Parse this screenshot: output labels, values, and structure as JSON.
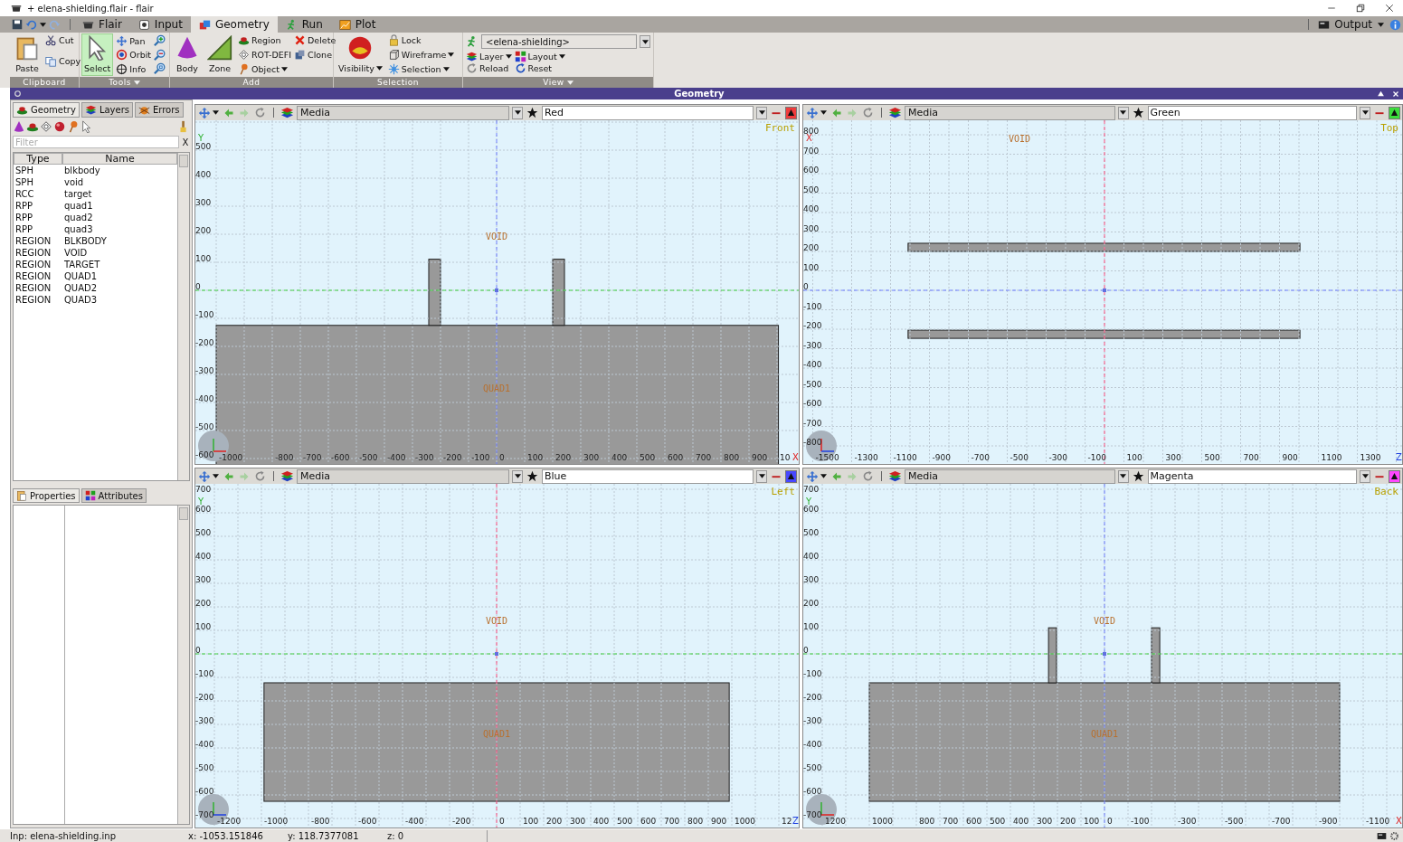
{
  "window": {
    "title": "+ elena-shielding.flair - flair"
  },
  "menu_tabs": [
    {
      "label": "Flair",
      "selected": false
    },
    {
      "label": "Input",
      "selected": false
    },
    {
      "label": "Geometry",
      "selected": true
    },
    {
      "label": "Run",
      "selected": false
    },
    {
      "label": "Plot",
      "selected": false
    }
  ],
  "output_menu": {
    "label": "Output"
  },
  "ribbon": [
    {
      "label": "Clipboard",
      "has_menu": false,
      "items": [
        {
          "kind": "large",
          "label": "Paste",
          "has_menu": false
        },
        {
          "kind": "small",
          "label": "Cut",
          "has_menu": false
        },
        {
          "kind": "small",
          "label": "Copy",
          "has_menu": false
        }
      ]
    },
    {
      "label": "Tools",
      "has_menu": true,
      "items": [
        {
          "kind": "large",
          "label": "Select",
          "has_menu": false,
          "selected": true
        },
        {
          "kind": "small",
          "label": "Pan",
          "has_menu": false,
          "selected": false
        },
        {
          "kind": "small",
          "label": "Orbit",
          "has_menu": false,
          "selected": false
        },
        {
          "kind": "small",
          "label": "Info",
          "has_menu": false,
          "selected": false
        },
        {
          "kind": "icon",
          "has_menu": false,
          "selected": false
        },
        {
          "kind": "icon",
          "has_menu": false,
          "selected": false
        },
        {
          "kind": "icon",
          "has_menu": false,
          "selected": false
        }
      ]
    },
    {
      "label": "Add",
      "has_menu": false,
      "items": [
        {
          "kind": "large",
          "label": "Body",
          "has_menu": false
        },
        {
          "kind": "large",
          "label": "Zone",
          "has_menu": false
        },
        {
          "kind": "small",
          "label": "Region",
          "has_menu": false
        },
        {
          "kind": "small",
          "label": "ROT-DEFI",
          "has_menu": false
        },
        {
          "kind": "small",
          "label": "Object",
          "has_menu": true
        },
        {
          "kind": "small",
          "label": "Delete",
          "has_menu": false
        },
        {
          "kind": "small",
          "label": "Clone",
          "has_menu": false
        }
      ]
    },
    {
      "label": "Selection",
      "has_menu": false,
      "items": [
        {
          "kind": "large",
          "label": "Visibility",
          "has_menu": true
        },
        {
          "kind": "small",
          "label": "Lock",
          "has_menu": false
        },
        {
          "kind": "small",
          "label": "Wireframe",
          "has_menu": true
        },
        {
          "kind": "small",
          "label": "Selection",
          "has_menu": true
        }
      ]
    },
    {
      "label": "View",
      "has_menu": true,
      "items": [
        {
          "kind": "combo",
          "label": "<elena-shielding>",
          "has_menu": false
        },
        {
          "kind": "small",
          "label": "Layer",
          "has_menu": true
        },
        {
          "kind": "small",
          "label": "Reload",
          "has_menu": false
        },
        {
          "kind": "small",
          "label": "Layout",
          "has_menu": true
        },
        {
          "kind": "small",
          "label": "Reset",
          "has_menu": false
        }
      ]
    }
  ],
  "panel_title": "Geometry",
  "sidebar": {
    "tabs": [
      {
        "label": "Geometry",
        "selected": true
      },
      {
        "label": "Layers",
        "selected": false
      },
      {
        "label": "Errors",
        "selected": false
      }
    ],
    "filter": {
      "placeholder": "Filter"
    },
    "clear_label": "X",
    "table": {
      "columns": [
        "Type",
        "Name"
      ],
      "rows": [
        [
          "SPH",
          "blkbody"
        ],
        [
          "SPH",
          "void"
        ],
        [
          "RCC",
          "target"
        ],
        [
          "RPP",
          "quad1"
        ],
        [
          "RPP",
          "quad2"
        ],
        [
          "RPP",
          "quad3"
        ],
        [
          "REGION",
          "BLKBODY"
        ],
        [
          "REGION",
          "VOID"
        ],
        [
          "REGION",
          "TARGET"
        ],
        [
          "REGION",
          "QUAD1"
        ],
        [
          "REGION",
          "QUAD2"
        ],
        [
          "REGION",
          "QUAD3"
        ]
      ]
    },
    "bottom_tabs": [
      {
        "label": "Properties",
        "selected": true
      },
      {
        "label": "Attributes",
        "selected": false
      }
    ]
  },
  "viewports": [
    {
      "layer": "Media",
      "color_name": "Red",
      "color": "#f03c3c",
      "view": "Front",
      "v_axis": "Y",
      "h_axis": "X",
      "y_ticks": [
        "500",
        "400",
        "300",
        "200",
        "100",
        "0",
        "-100",
        "-200",
        "-300",
        "-400",
        "-500",
        "-600"
      ],
      "x_ticks": [
        "-1000",
        "-800",
        "-700",
        "-600",
        "-500",
        "-400",
        "-300",
        "-200",
        "-100",
        "0",
        "100",
        "200",
        "300",
        "400",
        "500",
        "600",
        "700",
        "800",
        "900",
        "10"
      ],
      "region_labels": [
        "VOID",
        "QUAD1"
      ]
    },
    {
      "layer": "Media",
      "color_name": "Green",
      "color": "#3cdc3c",
      "view": "Top",
      "v_axis": "X",
      "h_axis": "Z",
      "y_ticks": [
        "800",
        "700",
        "600",
        "500",
        "400",
        "300",
        "200",
        "100",
        "0",
        "-100",
        "-200",
        "-300",
        "-400",
        "-500",
        "-600",
        "-700",
        "-800"
      ],
      "x_ticks": [
        "-1500",
        "-1300",
        "-1100",
        "-900",
        "-700",
        "-500",
        "-300",
        "-100",
        "100",
        "300",
        "500",
        "700",
        "900",
        "1100",
        "1300"
      ],
      "region_labels": [
        "VOID"
      ]
    },
    {
      "layer": "Media",
      "color_name": "Blue",
      "color": "#4848ff",
      "view": "Left",
      "v_axis": "Y",
      "h_axis": "Z",
      "y_ticks": [
        "700",
        "600",
        "500",
        "400",
        "300",
        "200",
        "100",
        "0",
        "-100",
        "-200",
        "-300",
        "-400",
        "-500",
        "-600",
        "-700"
      ],
      "x_ticks": [
        "-1200",
        "-1000",
        "-800",
        "-600",
        "-400",
        "-200",
        "0",
        "100",
        "200",
        "300",
        "400",
        "500",
        "600",
        "700",
        "800",
        "900",
        "1000",
        "12"
      ],
      "region_labels": [
        "VOID",
        "QUAD1"
      ]
    },
    {
      "layer": "Media",
      "color_name": "Magenta",
      "color": "#ff46ff",
      "view": "Back",
      "v_axis": "Y",
      "h_axis": "X",
      "y_ticks": [
        "700",
        "600",
        "500",
        "400",
        "300",
        "200",
        "100",
        "0",
        "-100",
        "-200",
        "-300",
        "-400",
        "-500",
        "-600",
        "-700"
      ],
      "x_ticks": [
        "1200",
        "1000",
        "800",
        "700",
        "600",
        "500",
        "400",
        "300",
        "200",
        "100",
        "0",
        "-100",
        "-300",
        "-500",
        "-700",
        "-900",
        "-1100"
      ],
      "region_labels": [
        "VOID",
        "QUAD1"
      ]
    }
  ],
  "status_bar": {
    "input": "Inp: elena-shielding.inp",
    "x": "x: -1053.151846",
    "y": "y: 118.7377081",
    "z": "z: 0"
  }
}
